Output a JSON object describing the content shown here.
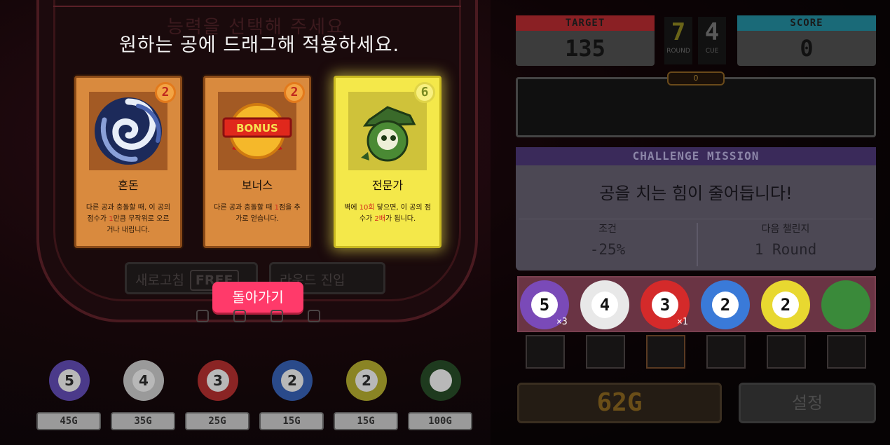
{
  "header": {
    "faded_title": "능력을 선택해 주세요",
    "instruction": "원하는 공에 드래그해 적용하세요."
  },
  "cards": [
    {
      "name": "혼돈",
      "cost": "2",
      "desc_pre": "다른 공과 충돌할 때, 이 공의 점수가 ",
      "desc_hl": "1",
      "desc_post": "만큼 무작위로 오르거나 내립니다.",
      "icon": "chaos-vortex-icon"
    },
    {
      "name": "보너스",
      "cost": "2",
      "desc_pre": "다른 공과 충돌할 때 ",
      "desc_hl": "1",
      "desc_post": "점을 추가로 얻습니다.",
      "icon": "bonus-badge-icon",
      "icon_text": "BONUS"
    },
    {
      "name": "전문가",
      "cost": "6",
      "desc_pre": "벽에 ",
      "desc_hl": "10회",
      "desc_mid": " 닿으면, 이 공의 점수가 ",
      "desc_hl2": "2배",
      "desc_post": "가 됩니다.",
      "icon": "expert-ball-icon"
    }
  ],
  "actions": {
    "refresh_label": "새로고침",
    "free_label": "FREE",
    "enter_round_label": "라운드 진입",
    "back_label": "돌아가기"
  },
  "shop_balls": [
    {
      "number": "5",
      "price": "45G",
      "color": "#4b3a8a"
    },
    {
      "number": "4",
      "price": "35G",
      "color": "#9a9a9a"
    },
    {
      "number": "3",
      "price": "25G",
      "color": "#8a2424"
    },
    {
      "number": "2",
      "price": "15G",
      "color": "#2a4a8a"
    },
    {
      "number": "2",
      "price": "15G",
      "color": "#8a8424"
    },
    {
      "number": "",
      "price": "100G",
      "color": "#1e3a1e"
    }
  ],
  "hud": {
    "target_label": "TARGET",
    "target_value": "135",
    "round_value": "7",
    "round_label": "ROUND",
    "cue_value": "4",
    "cue_label": "CUE",
    "score_label": "SCORE",
    "score_value": "0",
    "power_value": "0"
  },
  "mission": {
    "header": "CHALLENGE MISSION",
    "text": "공을 치는 힘이 줄어듭니다!",
    "condition_label": "조건",
    "condition_value": "-25%",
    "next_label": "다음 챌린지",
    "next_value": "1 Round"
  },
  "player_balls": [
    {
      "number": "5",
      "ring": "#7a4ab8",
      "mult": "×3"
    },
    {
      "number": "4",
      "ring": "#e8e8e8",
      "mult": ""
    },
    {
      "number": "3",
      "ring": "#d42a2a",
      "mult": "×1"
    },
    {
      "number": "2",
      "ring": "#3a7ad8",
      "mult": ""
    },
    {
      "number": "2",
      "ring": "#e8d830",
      "mult": ""
    },
    {
      "number": "",
      "ring": "#3a8a3a",
      "mult": ""
    }
  ],
  "footer": {
    "gold": "62G",
    "settings_label": "설정"
  }
}
